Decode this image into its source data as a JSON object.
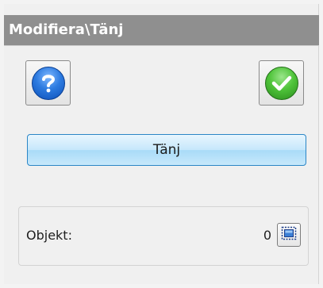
{
  "panel": {
    "title": "Modifiera\\Tänj"
  },
  "toolbar": {
    "help_icon": "help-icon",
    "ok_icon": "checkmark-icon"
  },
  "action": {
    "label": "Tänj"
  },
  "objekt": {
    "label": "Objekt:",
    "count": "0",
    "select_icon": "select-objects-icon"
  },
  "colors": {
    "title_bg": "#8f8f8f",
    "accent_blue": "#2b86c6",
    "help_blue": "#2d7be0",
    "ok_green": "#4fc43a"
  }
}
